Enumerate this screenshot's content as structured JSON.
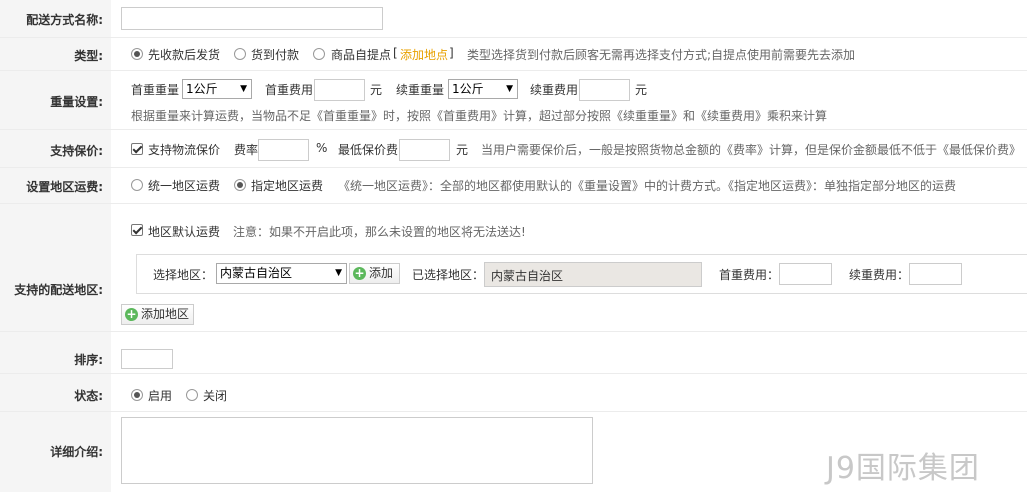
{
  "rows": {
    "name": {
      "label": "配送方式名称:"
    },
    "type": {
      "label": "类型:",
      "opt1": "先收款后发货",
      "opt2": "货到付款",
      "opt3": "商品自提点",
      "bracket_open": "[",
      "add_point": "添加地点",
      "bracket_close": "]",
      "hint": "类型选择货到付款后顾客无需再选择支付方式;自提点使用前需要先去添加"
    },
    "weight": {
      "label": "重量设置:",
      "first_weight": "首重重量",
      "first_weight_value": "1公斤",
      "first_fee": "首重费用",
      "unit1": "元",
      "cont_weight": "续重重量",
      "cont_weight_value": "1公斤",
      "cont_fee": "续重费用",
      "unit2": "元",
      "hint": "根据重量来计算运费，当物品不足《首重重量》时，按照《首重费用》计算，超过部分按照《续重重量》和《续重费用》乘积来计算"
    },
    "insure": {
      "label": "支持保价:",
      "check": "支持物流保价",
      "rate": "费率",
      "percent": "%",
      "min_fee": "最低保价费",
      "unit": "元",
      "hint": "当用户需要保价后，一般是按照货物总金额的《费率》计算，但是保价金额最低不低于《最低保价费》"
    },
    "area": {
      "label": "设置地区运费:",
      "opt1": "统一地区运费",
      "opt2": "指定地区运费",
      "hint": "《统一地区运费》：全部的地区都使用默认的《重量设置》中的计费方式。《指定地区运费》：单独指定部分地区的运费"
    },
    "regions": {
      "label": "支持的配送地区:",
      "default_check": "地区默认运费",
      "default_hint": "注意：如果不开启此项，那么未设置的地区将无法送达!",
      "select_label": "选择地区：",
      "select_value": "内蒙古自治区",
      "add_btn": "添加",
      "selected_label": "已选择地区：",
      "selected_value": "内蒙古自治区",
      "first_fee": "首重费用：",
      "cont_fee": "续重费用：",
      "add_region_btn": "添加地区"
    },
    "sort": {
      "label": "排序:"
    },
    "status": {
      "label": "状态:",
      "opt1": "启用",
      "opt2": "关闭"
    },
    "detail": {
      "label": "详细介绍:"
    }
  },
  "watermark": "J9国际集团"
}
